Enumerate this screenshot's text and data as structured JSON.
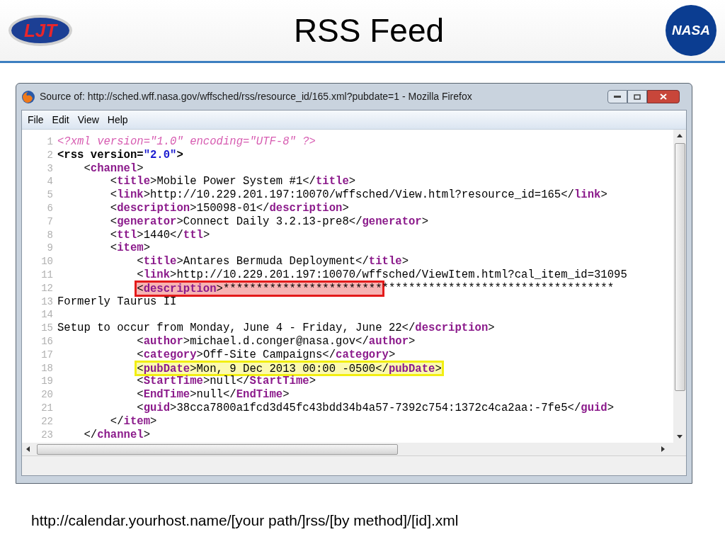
{
  "slide": {
    "title": "RSS Feed",
    "left_logo": "LJT",
    "right_logo": "NASA",
    "footer": "http://calendar.yourhost.name/[your path/]rss/[by method]/[id].xml"
  },
  "window": {
    "title": "Source of: http://sched.wff.nasa.gov/wffsched/rss/resource_id/165.xml?pubdate=1 - Mozilla Firefox"
  },
  "menu": [
    "File",
    "Edit",
    "View",
    "Help"
  ],
  "lines": [
    {
      "num": "1",
      "groups": [
        {
          "tokens": [
            {
              "kind": "pi",
              "text": "<?xml version=\"1.0\" encoding=\"UTF-8\" ?>"
            }
          ]
        }
      ]
    },
    {
      "num": "2",
      "groups": [
        {
          "tokens": [
            {
              "kind": "attr",
              "text": "<rss version="
            },
            {
              "kind": "value",
              "text": "\"2.0\""
            },
            {
              "kind": "attr",
              "text": ">"
            }
          ]
        }
      ]
    },
    {
      "num": "3",
      "groups": [
        {
          "tokens": [
            {
              "kind": "text",
              "text": "    <"
            },
            {
              "kind": "tag",
              "text": "channel"
            },
            {
              "kind": "text",
              "text": ">"
            }
          ]
        }
      ]
    },
    {
      "num": "4",
      "groups": [
        {
          "tokens": [
            {
              "kind": "text",
              "text": "        <"
            },
            {
              "kind": "tag",
              "text": "title"
            },
            {
              "kind": "text",
              "text": ">Mobile Power System #1</"
            },
            {
              "kind": "tag",
              "text": "title"
            },
            {
              "kind": "text",
              "text": ">"
            }
          ]
        }
      ]
    },
    {
      "num": "5",
      "groups": [
        {
          "tokens": [
            {
              "kind": "text",
              "text": "        <"
            },
            {
              "kind": "tag",
              "text": "link"
            },
            {
              "kind": "text",
              "text": ">http://10.229.201.197:10070/wffsched/View.html?resource_id=165</"
            },
            {
              "kind": "tag",
              "text": "link"
            },
            {
              "kind": "text",
              "text": ">"
            }
          ]
        }
      ]
    },
    {
      "num": "6",
      "groups": [
        {
          "tokens": [
            {
              "kind": "text",
              "text": "        <"
            },
            {
              "kind": "tag",
              "text": "description"
            },
            {
              "kind": "text",
              "text": ">150098-01</"
            },
            {
              "kind": "tag",
              "text": "description"
            },
            {
              "kind": "text",
              "text": ">"
            }
          ]
        }
      ]
    },
    {
      "num": "7",
      "groups": [
        {
          "tokens": [
            {
              "kind": "text",
              "text": "        <"
            },
            {
              "kind": "tag",
              "text": "generator"
            },
            {
              "kind": "text",
              "text": ">Connect Daily 3.2.13-pre8</"
            },
            {
              "kind": "tag",
              "text": "generator"
            },
            {
              "kind": "text",
              "text": ">"
            }
          ]
        }
      ]
    },
    {
      "num": "8",
      "groups": [
        {
          "tokens": [
            {
              "kind": "text",
              "text": "        <"
            },
            {
              "kind": "tag",
              "text": "ttl"
            },
            {
              "kind": "text",
              "text": ">1440</"
            },
            {
              "kind": "tag",
              "text": "ttl"
            },
            {
              "kind": "text",
              "text": ">"
            }
          ]
        }
      ]
    },
    {
      "num": "9",
      "groups": [
        {
          "tokens": [
            {
              "kind": "text",
              "text": "        <"
            },
            {
              "kind": "tag",
              "text": "item"
            },
            {
              "kind": "text",
              "text": ">"
            }
          ]
        }
      ]
    },
    {
      "num": "10",
      "groups": [
        {
          "tokens": [
            {
              "kind": "text",
              "text": "            <"
            },
            {
              "kind": "tag",
              "text": "title"
            },
            {
              "kind": "text",
              "text": ">Antares Bermuda Deployment</"
            },
            {
              "kind": "tag",
              "text": "title"
            },
            {
              "kind": "text",
              "text": ">"
            }
          ]
        }
      ]
    },
    {
      "num": "11",
      "groups": [
        {
          "tokens": [
            {
              "kind": "text",
              "text": "            <"
            },
            {
              "kind": "tag",
              "text": "link"
            },
            {
              "kind": "text",
              "text": ">http://10.229.201.197:10070/wffsched/ViewItem.html?cal_item_id=31095"
            }
          ]
        }
      ]
    },
    {
      "num": "12",
      "groups": [
        {
          "color": "#e31b1b",
          "tokens": [
            {
              "kind": "text",
              "text": "<"
            },
            {
              "kind": "tag",
              "text": "description"
            },
            {
              "kind": "text",
              "text": ">************************"
            }
          ]
        },
        {
          "tokens": [
            {
              "kind": "text",
              "text": "***********************************"
            }
          ]
        }
      ]
    },
    {
      "num": "13",
      "groups": [
        {
          "tokens": [
            {
              "kind": "text",
              "text": "Formerly Taurus II"
            }
          ]
        }
      ]
    },
    {
      "num": "14"
    },
    {
      "num": "15",
      "groups": [
        {
          "tokens": [
            {
              "kind": "text",
              "text": "Setup to occur from Monday, June 4 - Friday, June 22</"
            },
            {
              "kind": "tag",
              "text": "description"
            },
            {
              "kind": "text",
              "text": ">"
            }
          ]
        }
      ]
    },
    {
      "num": "16",
      "groups": [
        {
          "tokens": [
            {
              "kind": "text",
              "text": "            <"
            },
            {
              "kind": "tag",
              "text": "author"
            },
            {
              "kind": "text",
              "text": ">michael.d.conger@nasa.gov</"
            },
            {
              "kind": "tag",
              "text": "author"
            },
            {
              "kind": "text",
              "text": ">"
            }
          ]
        }
      ]
    },
    {
      "num": "17",
      "groups": [
        {
          "tokens": [
            {
              "kind": "text",
              "text": "            <"
            },
            {
              "kind": "tag",
              "text": "category"
            },
            {
              "kind": "text",
              "text": ">Off-Site Campaigns</"
            },
            {
              "kind": "tag",
              "text": "category"
            },
            {
              "kind": "text",
              "text": ">"
            }
          ]
        }
      ]
    },
    {
      "num": "18",
      "groups": [
        {
          "color": "#f2ee12",
          "tokens": [
            {
              "kind": "text",
              "text": "<"
            },
            {
              "kind": "tag",
              "text": "pubDate"
            },
            {
              "kind": "text",
              "text": ">Mon, 9 Dec 2013 00:00 -0500</"
            },
            {
              "kind": "tag",
              "text": "pubDate"
            },
            {
              "kind": "text",
              "text": ">"
            }
          ]
        }
      ]
    },
    {
      "num": "19",
      "groups": [
        {
          "tokens": [
            {
              "kind": "text",
              "text": "            <"
            },
            {
              "kind": "tag",
              "text": "StartTime"
            },
            {
              "kind": "text",
              "text": ">null</"
            },
            {
              "kind": "tag",
              "text": "StartTime"
            },
            {
              "kind": "text",
              "text": ">"
            }
          ]
        }
      ]
    },
    {
      "num": "20",
      "groups": [
        {
          "tokens": [
            {
              "kind": "text",
              "text": "            <"
            },
            {
              "kind": "tag",
              "text": "EndTime"
            },
            {
              "kind": "text",
              "text": ">null</"
            },
            {
              "kind": "tag",
              "text": "EndTime"
            },
            {
              "kind": "text",
              "text": ">"
            }
          ]
        }
      ]
    },
    {
      "num": "21",
      "groups": [
        {
          "tokens": [
            {
              "kind": "text",
              "text": "            <"
            },
            {
              "kind": "tag",
              "text": "guid"
            },
            {
              "kind": "text",
              "text": ">38cca7800a1fcd3d45fc43bdd34b4a57-7392c754:1372c4ca2aa:-7fe5</"
            },
            {
              "kind": "tag",
              "text": "guid"
            },
            {
              "kind": "text",
              "text": ">"
            }
          ]
        }
      ]
    },
    {
      "num": "22",
      "groups": [
        {
          "tokens": [
            {
              "kind": "text",
              "text": "        </"
            },
            {
              "kind": "tag",
              "text": "item"
            },
            {
              "kind": "text",
              "text": ">"
            }
          ]
        }
      ]
    },
    {
      "num": "23",
      "groups": [
        {
          "tokens": [
            {
              "kind": "text",
              "text": "    </"
            },
            {
              "kind": "tag",
              "text": "channel"
            },
            {
              "kind": "text",
              "text": ">"
            }
          ]
        }
      ]
    }
  ]
}
